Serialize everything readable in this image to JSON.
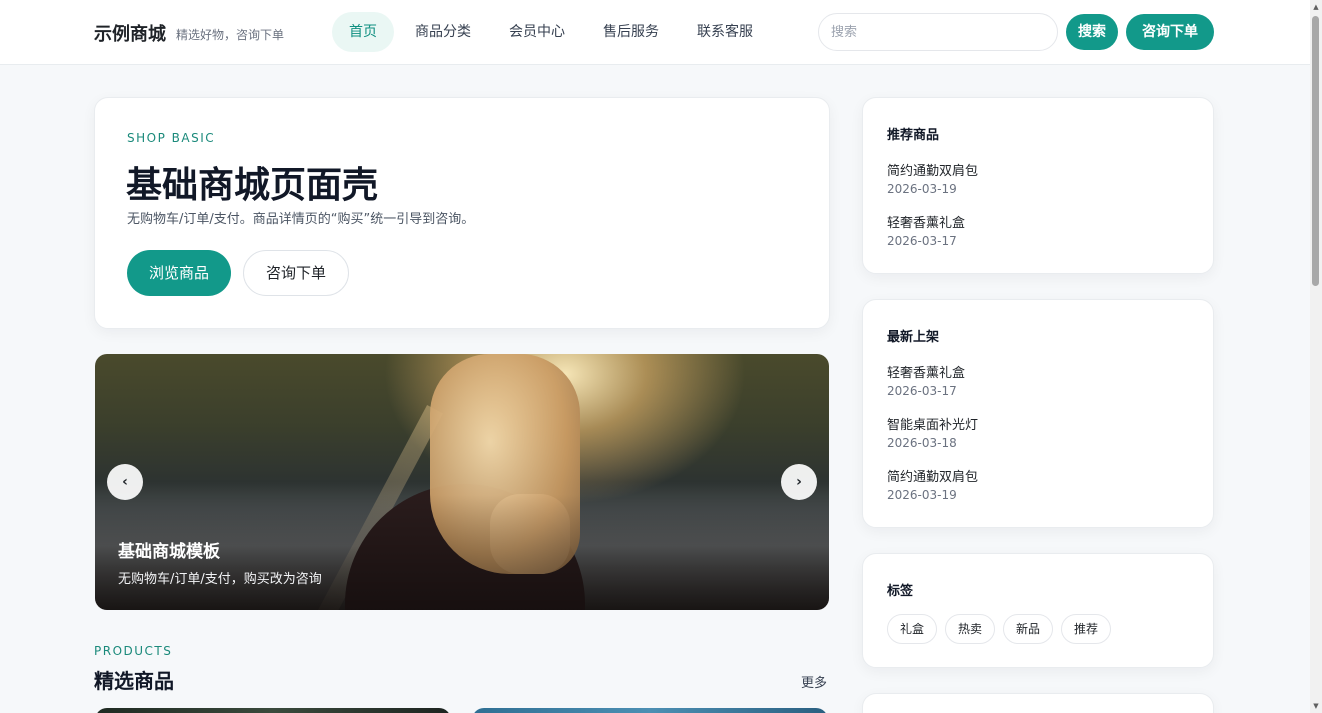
{
  "header": {
    "brand": "示例商城",
    "slogan": "精选好物，咨询下单",
    "nav": [
      "首页",
      "商品分类",
      "会员中心",
      "售后服务",
      "联系客服"
    ],
    "search_placeholder": "搜索",
    "search_button": "搜索",
    "consult_button": "咨询下单"
  },
  "hero": {
    "eyebrow": "SHOP BASIC",
    "title": "基础商城页面壳",
    "description": "无购物车/订单/支付。商品详情页的“购买”统一引导到咨询。",
    "primary_button": "浏览商品",
    "secondary_button": "咨询下单"
  },
  "banner": {
    "title": "基础商城模板",
    "subtitle": "无购物车/订单/支付，购买改为咨询",
    "prev_icon": "‹",
    "next_icon": "›"
  },
  "products": {
    "eyebrow": "PRODUCTS",
    "title": "精选商品",
    "more": "更多"
  },
  "sidebar": {
    "recommended": {
      "title": "推荐商品",
      "items": [
        {
          "name": "简约通勤双肩包",
          "date": "2026-03-19"
        },
        {
          "name": "轻奢香薰礼盒",
          "date": "2026-03-17"
        }
      ]
    },
    "latest": {
      "title": "最新上架",
      "items": [
        {
          "name": "轻奢香薰礼盒",
          "date": "2026-03-17"
        },
        {
          "name": "智能桌面补光灯",
          "date": "2026-03-18"
        },
        {
          "name": "简约通勤双肩包",
          "date": "2026-03-19"
        }
      ]
    },
    "tags": {
      "title": "标签",
      "items": [
        "礼盒",
        "热卖",
        "新品",
        "推荐"
      ]
    }
  },
  "colors": {
    "accent": "#12998a",
    "accent_text": "#1b8a7b",
    "background": "#f6f8fa"
  }
}
